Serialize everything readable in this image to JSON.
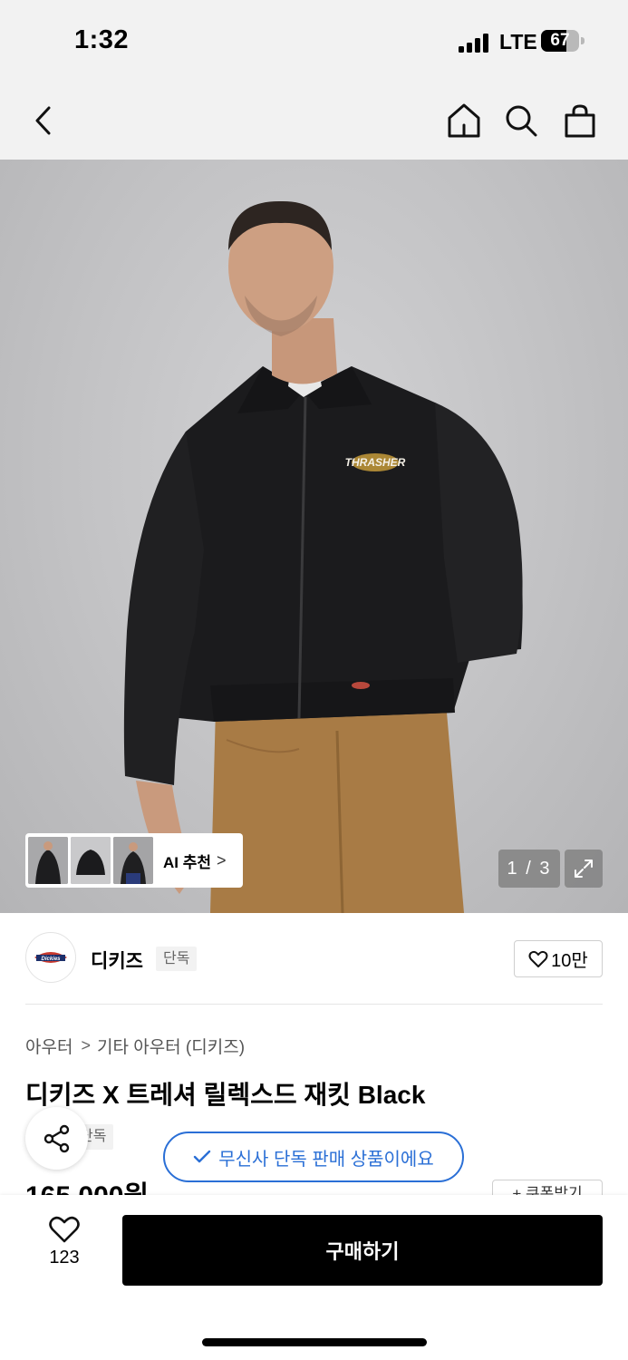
{
  "status_bar": {
    "time": "1:32",
    "network": "LTE",
    "battery_level": "67",
    "battery_fraction": 0.67
  },
  "nav": {
    "back_icon": "chevron-left-icon",
    "home_icon": "home-icon",
    "search_icon": "search-icon",
    "cart_icon": "shopping-bag-icon"
  },
  "gallery": {
    "image_counter": "1 / 3",
    "ai_recommend_label": "AI 추천",
    "ai_recommend_chevron": ">",
    "expand_icon": "expand-icon"
  },
  "brand": {
    "logo_text": "Dickies",
    "name": "디키즈",
    "badge": "단독",
    "like_count": "10만"
  },
  "product": {
    "breadcrumb": [
      "아우터",
      "기타 아우터 (디키즈)"
    ],
    "breadcrumb_separator": ">",
    "title": "디키즈 X 트레셔 릴렉스드 재킷 Black",
    "exclusive_tag": "단독",
    "exclusive_notice": "무신사 단독 판매 상품이에요",
    "price": "165,000원",
    "coupon_label": "+ 쿠폰받기"
  },
  "bottom_bar": {
    "favorite_count": "123",
    "buy_label": "구매하기"
  },
  "colors": {
    "accent_blue": "#2a6fd6",
    "buy_button": "#000000",
    "header_bg": "#f2f2f2"
  }
}
